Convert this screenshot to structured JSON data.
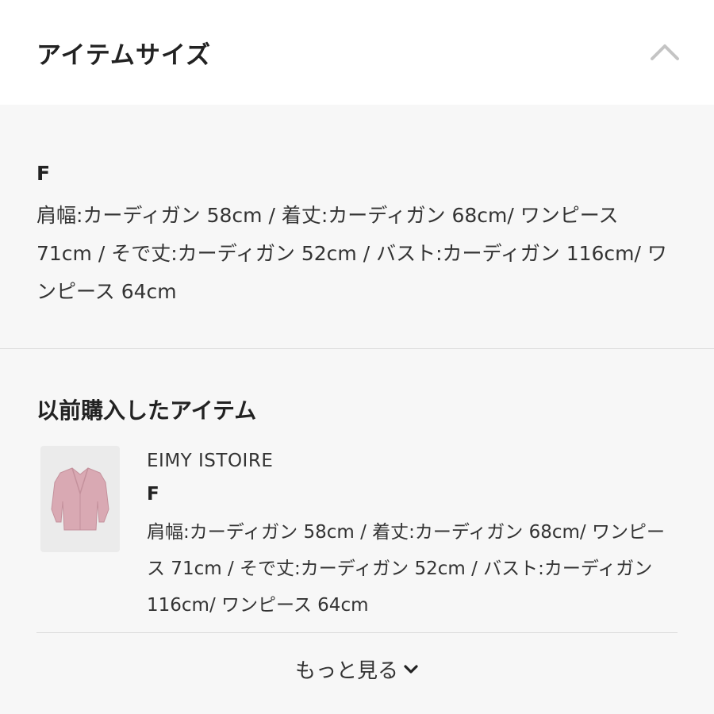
{
  "header": {
    "title": "アイテムサイズ"
  },
  "size": {
    "label": "F",
    "description": "肩幅:カーディガン 58cm / 着丈:カーディガン 68cm/ ワンピース 71cm / そで丈:カーディガン 52cm / バスト:カーディガン 116cm/ ワンピース 64cm"
  },
  "previous": {
    "title": "以前購入したアイテム",
    "item": {
      "brand": "EIMY ISTOIRE",
      "size": "F",
      "description": "肩幅:カーディガン 58cm / 着丈:カーディガン 68cm/ ワンピース 71cm / そで丈:カーディガン 52cm / バスト:カーディガン 116cm/ ワンピース 64cm",
      "thumbnail_color": "#d9a9b3"
    }
  },
  "more": {
    "label": "もっと見る"
  },
  "icons": {
    "collapse": "chevron-up-icon",
    "expand": "chevron-down-icon"
  },
  "colors": {
    "background": "#f7f7f7",
    "header_background": "#ffffff",
    "divider": "#dcdcdc"
  }
}
